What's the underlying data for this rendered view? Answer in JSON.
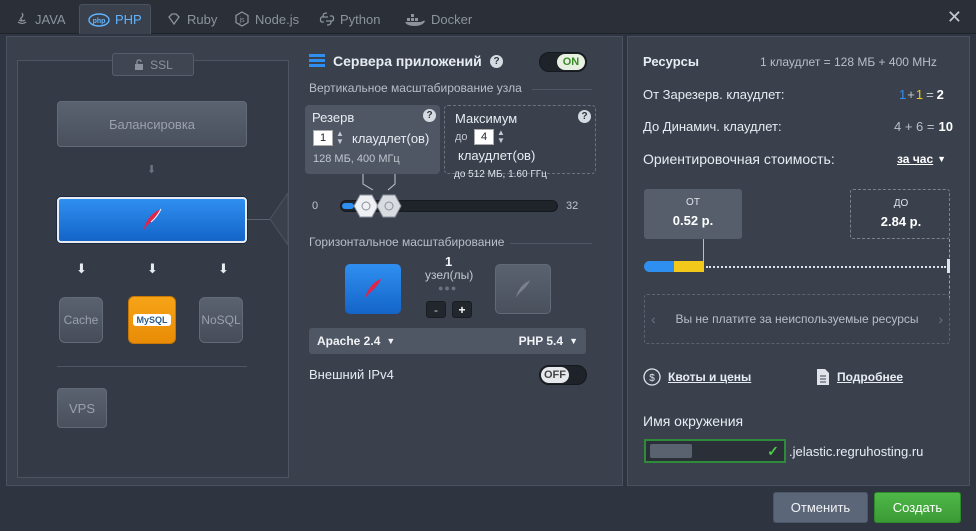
{
  "tabs": [
    {
      "label": "JAVA",
      "icon": "java-icon",
      "active": false
    },
    {
      "label": "PHP",
      "icon": "php-icon",
      "active": true
    },
    {
      "label": "Ruby",
      "icon": "ruby-icon",
      "active": false
    },
    {
      "label": "Node.js",
      "icon": "nodejs-icon",
      "active": false
    },
    {
      "label": "Python",
      "icon": "python-icon",
      "active": false
    },
    {
      "label": "Docker",
      "icon": "docker-icon",
      "active": false
    }
  ],
  "topology": {
    "ssl_label": "SSL",
    "balancer_label": "Балансировка",
    "cache_label": "Cache",
    "mysql_label": "MySQL",
    "nosql_label": "NoSQL",
    "vps_label": "VPS"
  },
  "config": {
    "title": "Сервера приложений",
    "toggle_on": "ON",
    "vertical_scaling": "Вертикальное масштабирование узла",
    "reserve": {
      "title": "Резерв",
      "value": "1",
      "unit": "клаудлет(ов)",
      "detail": "128 МБ, 400 МГц"
    },
    "maximum": {
      "title": "Максимум",
      "prefix": "до",
      "value": "4",
      "unit": "клаудлет(ов)",
      "detail": "до 512 МБ, 1.60 ГГц"
    },
    "slider_min": "0",
    "slider_max": "32",
    "horizontal_scaling": "Горизонтальное масштабирование",
    "nodes_count": "1",
    "nodes_unit": "узел(лы)",
    "minus": "-",
    "plus": "+",
    "server_select": "Apache 2.4",
    "php_select": "PHP 5.4",
    "ipv4_label": "Внешний IPv4",
    "toggle_off": "OFF"
  },
  "resources": {
    "title": "Ресурсы",
    "cloudlet_info": "1 клаудлет = 128 МБ + 400 MHz",
    "reserved_label": "От Зарезерв. клаудлет:",
    "reserved_a": "1",
    "reserved_plus": "+",
    "reserved_b": "1",
    "reserved_eq": "=",
    "reserved_total": "2",
    "dynamic_label": "До Динамич. клаудлет:",
    "dynamic_expr": "4 + 6 =",
    "dynamic_total": "10",
    "cost_label": "Ориентировочная стоимость:",
    "cost_period": "за час",
    "from_label": "ОТ",
    "from_value": "0.52 р.",
    "to_label": "ДО",
    "to_value": "2.84 р.",
    "note": "Вы не платите за неиспользуемые ресурсы",
    "quotas_link": "Квоты и цены",
    "details_link": "Подробнее",
    "env_label": "Имя окружения",
    "env_domain": ".jelastic.regruhosting.ru"
  },
  "footer": {
    "cancel": "Отменить",
    "create": "Создать"
  },
  "colors": {
    "accent": "#1e7be0",
    "ok": "#3a9a35",
    "bar_blue": "#2f8ff0",
    "bar_yellow": "#f2c81b"
  }
}
